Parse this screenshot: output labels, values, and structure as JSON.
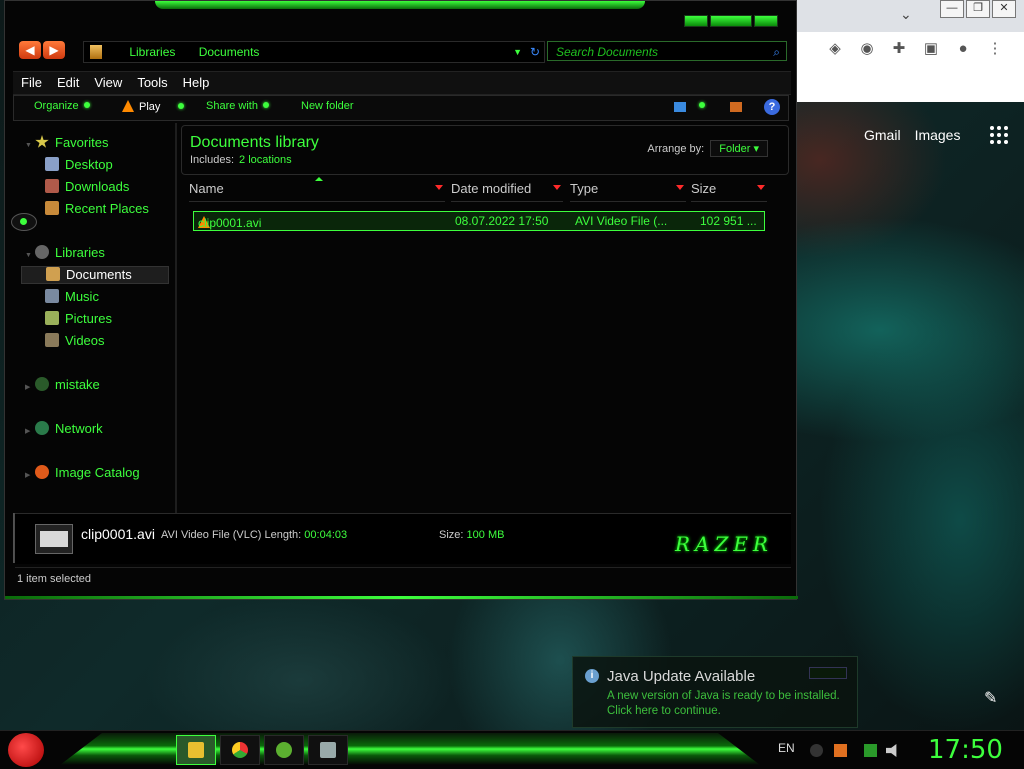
{
  "chrome": {
    "controls": [
      "—",
      "❐",
      "✕"
    ],
    "chevron": "⌄",
    "extensions": [
      "ublock-icon",
      "shield-icon",
      "puzzle-icon",
      "sidepanel-icon",
      "profile-icon",
      "more-icon"
    ],
    "links": [
      "Gmail",
      "Images"
    ]
  },
  "explorer": {
    "breadcrumb": [
      "Libraries",
      "Documents"
    ],
    "search_placeholder": "Search Documents",
    "menu": [
      "File",
      "Edit",
      "View",
      "Tools",
      "Help"
    ],
    "toolbar": {
      "organize": "Organize",
      "play": "Play",
      "share_with": "Share with",
      "new_folder": "New folder"
    },
    "nav": {
      "favorites": "Favorites",
      "desktop": "Desktop",
      "downloads": "Downloads",
      "recent_places": "Recent Places",
      "libraries": "Libraries",
      "documents": "Documents",
      "music": "Music",
      "pictures": "Pictures",
      "videos": "Videos",
      "mistake": "mistake",
      "network": "Network",
      "image_catalog": "Image Catalog"
    },
    "library": {
      "title": "Documents library",
      "includes_label": "Includes:",
      "includes_value": "2 locations",
      "arrange_label": "Arrange by:",
      "arrange_value": "Folder"
    },
    "columns": [
      "Name",
      "Date modified",
      "Type",
      "Size"
    ],
    "files": [
      {
        "name": "clip0001.avi",
        "date": "08.07.2022 17:50",
        "type": "AVI Video File (...",
        "size": "102 951 ..."
      }
    ],
    "details": {
      "name": "clip0001.avi",
      "type": "AVI Video File (VLC)",
      "length_label": "Length:",
      "length_value": "00:04:03",
      "size_label": "Size:",
      "size_value": "100 MB",
      "brand": "RAZER"
    },
    "status": "1 item selected"
  },
  "notification": {
    "title": "Java Update Available",
    "line1": "A new version of Java is ready to be installed.",
    "line2": "Click here to continue."
  },
  "taskbar": {
    "apps": [
      "explorer-icon",
      "chrome-icon",
      "utorrent-icon",
      "app-icon"
    ],
    "lang": "EN",
    "clock": "17:50"
  }
}
